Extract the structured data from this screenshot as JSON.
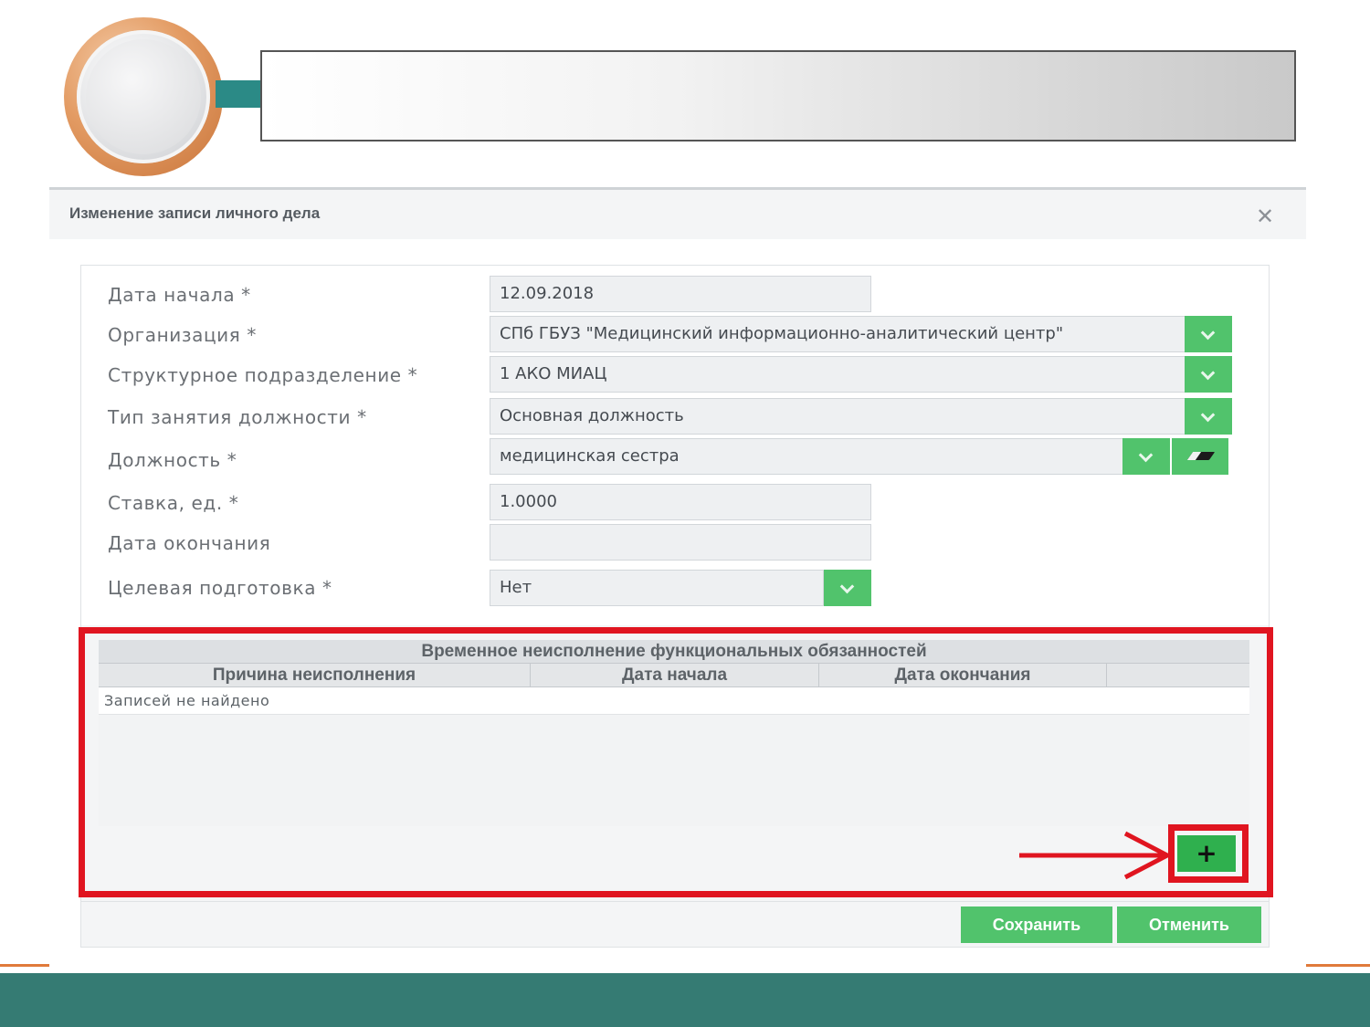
{
  "dialog": {
    "title": "Изменение записи личного дела",
    "close_icon": "close-icon"
  },
  "form": {
    "start_date": {
      "label": "Дата начала *",
      "value": "12.09.2018"
    },
    "organization": {
      "label": "Организация *",
      "value": "СПб ГБУЗ \"Медицинский информационно-аналитический центр\""
    },
    "department": {
      "label": "Структурное подразделение *",
      "value": "1 АКО МИАЦ"
    },
    "position_type": {
      "label": "Тип занятия должности *",
      "value": "Основная должность"
    },
    "position": {
      "label": "Должность *",
      "value": "медицинская сестра"
    },
    "rate": {
      "label": "Ставка, ед. *",
      "value": "1.0000"
    },
    "end_date": {
      "label": "Дата окончания",
      "value": ""
    },
    "targeted_training": {
      "label": "Целевая подготовка *",
      "value": "Нет"
    }
  },
  "absence_table": {
    "caption": "Временное неисполнение функциональных обязанностей",
    "columns": [
      "Причина неисполнения",
      "Дата начала",
      "Дата окончания",
      ""
    ],
    "empty_text": "Записей не найдено",
    "add_label": "+"
  },
  "buttons": {
    "save": "Сохранить",
    "cancel": "Отменить"
  },
  "colors": {
    "accent_green": "#51c36c",
    "highlight_red": "#e01520",
    "footer_teal": "#357b73",
    "orange": "#e07a3b"
  }
}
